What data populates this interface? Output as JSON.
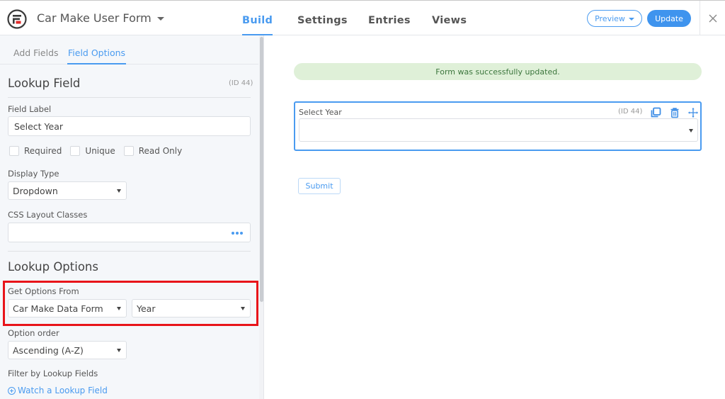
{
  "header": {
    "logo_icon": "formidable-logo-icon",
    "form_title": "Car Make User Form",
    "tabs": [
      {
        "label": "Build",
        "active": true
      },
      {
        "label": "Settings",
        "active": false
      },
      {
        "label": "Entries",
        "active": false
      },
      {
        "label": "Views",
        "active": false
      }
    ],
    "preview_label": "Preview",
    "update_label": "Update",
    "close_icon": "close-icon"
  },
  "sidebar": {
    "tabs": [
      {
        "label": "Add Fields",
        "active": false
      },
      {
        "label": "Field Options",
        "active": true
      }
    ],
    "field_type_title": "Lookup Field",
    "field_id": "(ID 44)",
    "field_label_label": "Field Label",
    "field_label_value": "Select Year",
    "checkboxes": [
      {
        "label": "Required",
        "checked": false
      },
      {
        "label": "Unique",
        "checked": false
      },
      {
        "label": "Read Only",
        "checked": false
      }
    ],
    "display_type_label": "Display Type",
    "display_type_value": "Dropdown",
    "css_classes_label": "CSS Layout Classes",
    "css_classes_value": "",
    "lookup_options_title": "Lookup Options",
    "get_options_label": "Get Options From",
    "get_options_form": "Car Make Data Form",
    "get_options_field": "Year",
    "option_order_label": "Option order",
    "option_order_value": "Ascending (A-Z)",
    "filter_label": "Filter by Lookup Fields",
    "watch_link": "Watch a Lookup Field"
  },
  "canvas": {
    "success_message": "Form was successfully updated.",
    "field": {
      "label": "Select Year",
      "id": "(ID 44)",
      "value": ""
    },
    "submit_label": "Submit"
  },
  "colors": {
    "accent": "#4a9bf0",
    "success_bg": "#dff0d8",
    "success_text": "#3c763d",
    "highlight": "#e8141a"
  }
}
